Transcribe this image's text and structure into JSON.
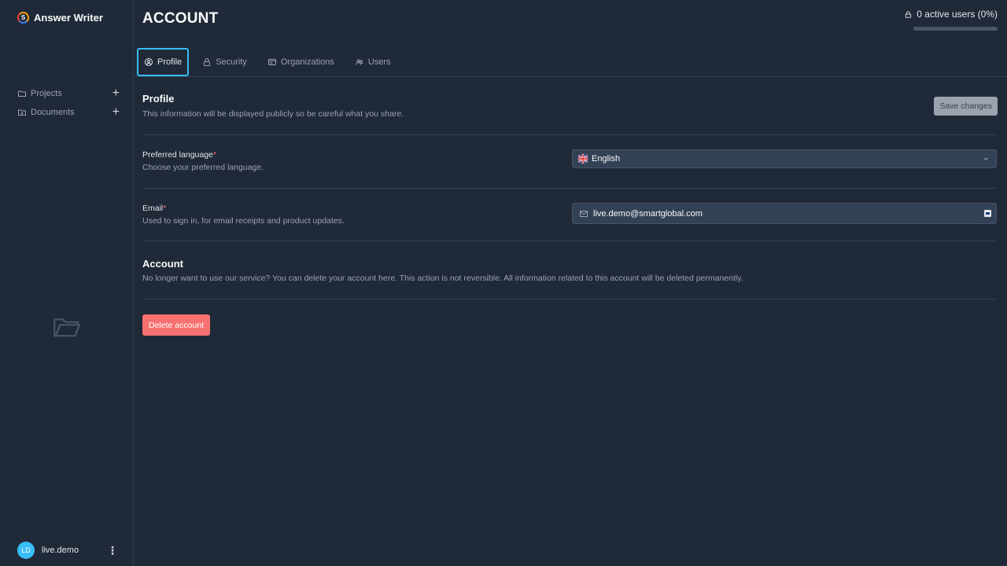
{
  "brand": {
    "name": "Answer Writer",
    "logo_letter": "S"
  },
  "sidebar": {
    "items": [
      {
        "label": "Projects",
        "icon": "folder-icon"
      },
      {
        "label": "Documents",
        "icon": "document-folder-icon"
      }
    ],
    "empty_state_icon": "open-folder-icon"
  },
  "user": {
    "initials": "LD",
    "name": "live.demo"
  },
  "header": {
    "title": "ACCOUNT",
    "active_users": "0 active users (0%)",
    "active_users_progress": 0
  },
  "tabs": [
    {
      "label": "Profile",
      "icon": "user-circle-icon",
      "active": true
    },
    {
      "label": "Security",
      "icon": "lock-icon",
      "active": false
    },
    {
      "label": "Organizations",
      "icon": "id-card-icon",
      "active": false
    },
    {
      "label": "Users",
      "icon": "users-icon",
      "active": false
    }
  ],
  "profile": {
    "title": "Profile",
    "description": "This information will be displayed publicly so be careful what you share.",
    "save_label": "Save changes"
  },
  "language": {
    "label": "Preferred language",
    "required_mark": "*",
    "description": "Choose your preferred language.",
    "value": "English",
    "flag": "uk-flag-icon"
  },
  "email": {
    "label": "Email",
    "required_mark": "*",
    "description": "Used to sign in, for email receipts and product updates.",
    "value": "live.demo@smartglobal.com"
  },
  "account": {
    "title": "Account",
    "description": "No longer want to use our service? You can delete your account here. This action is not reversible. All information related to this account will be deleted permanently.",
    "delete_label": "Delete account"
  },
  "colors": {
    "background": "#1f2937",
    "accent": "#38bdf8",
    "danger": "#f87171",
    "required": "#f87171"
  }
}
